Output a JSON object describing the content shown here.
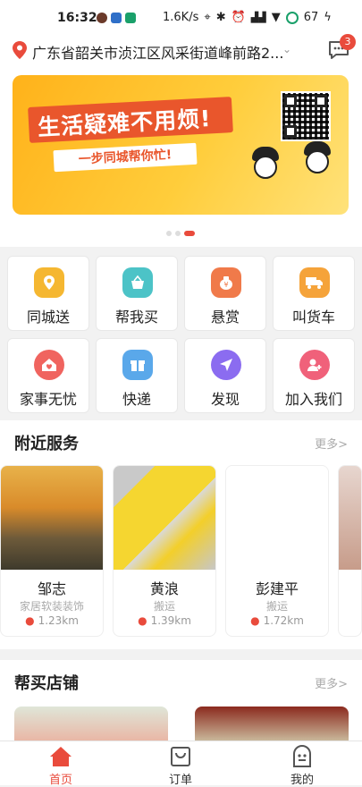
{
  "status_bar": {
    "time": "16:32",
    "network_speed": "1.6K/s",
    "battery": "67"
  },
  "location": {
    "address": "广东省韶关市浈江区风采街道峰前路2...",
    "message_badge": "3"
  },
  "banner": {
    "headline": "生活疑难不用烦!",
    "subline": "一步同城帮你忙!",
    "active_slide": 3,
    "slides": 3
  },
  "quick_menu": [
    {
      "label": "同城送",
      "icon": "location-pin-icon",
      "color": "#f5b731"
    },
    {
      "label": "帮我买",
      "icon": "shopping-basket-icon",
      "color": "#4cc3c7"
    },
    {
      "label": "悬赏",
      "icon": "money-bag-icon",
      "color": "#f07a4a"
    },
    {
      "label": "叫货车",
      "icon": "truck-icon",
      "color": "#f5a33a"
    },
    {
      "label": "家事无忧",
      "icon": "house-heart-icon",
      "color": "#f0645f"
    },
    {
      "label": "快递",
      "icon": "gift-box-icon",
      "color": "#5aa8ea"
    },
    {
      "label": "发现",
      "icon": "navigation-arrow-icon",
      "color": "#8b6cf0"
    },
    {
      "label": "加入我们",
      "icon": "add-user-icon",
      "color": "#f0617a"
    }
  ],
  "nearby": {
    "title": "附近服务",
    "more": "更多>",
    "cards": [
      {
        "name": "邹志",
        "category": "家居软装装饰",
        "distance": "1.23km"
      },
      {
        "name": "黄浪",
        "category": "搬运",
        "distance": "1.39km"
      },
      {
        "name": "彭建平",
        "category": "搬运",
        "distance": "1.72km"
      }
    ]
  },
  "shops": {
    "title": "帮买店铺",
    "more": "更多>"
  },
  "tab_bar": [
    {
      "label": "首页",
      "icon": "home-icon",
      "active": true
    },
    {
      "label": "订单",
      "icon": "order-bag-icon",
      "active": false
    },
    {
      "label": "我的",
      "icon": "profile-icon",
      "active": false
    }
  ],
  "colors": {
    "accent": "#e94b3c",
    "banner_yellow": "#ffc12e"
  }
}
